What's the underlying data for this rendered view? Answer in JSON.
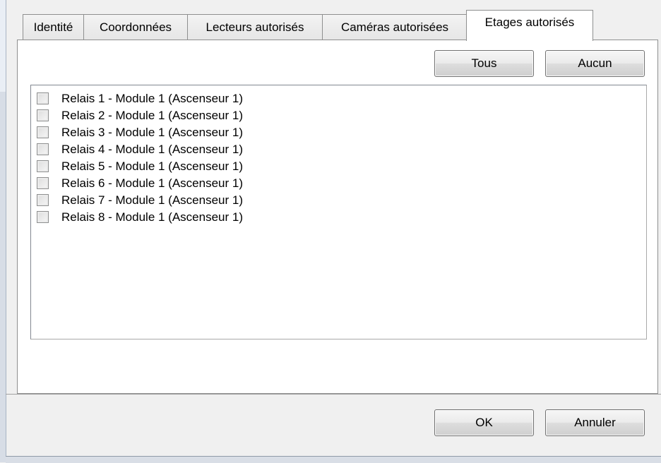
{
  "tabs": [
    {
      "label": "Identité"
    },
    {
      "label": "Coordonnées"
    },
    {
      "label": "Lecteurs autorisés"
    },
    {
      "label": "Caméras autorisées"
    },
    {
      "label": "Etages autorisés",
      "active": true
    }
  ],
  "panel": {
    "all_button": "Tous",
    "none_button": "Aucun",
    "relays": [
      {
        "label": "Relais 1 - Module 1 (Ascenseur 1)",
        "checked": false
      },
      {
        "label": "Relais 2 - Module 1 (Ascenseur 1)",
        "checked": false
      },
      {
        "label": "Relais 3 - Module 1 (Ascenseur 1)",
        "checked": false
      },
      {
        "label": "Relais 4 - Module 1 (Ascenseur 1)",
        "checked": false
      },
      {
        "label": "Relais 5 - Module 1 (Ascenseur 1)",
        "checked": false
      },
      {
        "label": "Relais 6 - Module 1 (Ascenseur 1)",
        "checked": false
      },
      {
        "label": "Relais 7 - Module 1 (Ascenseur 1)",
        "checked": false
      },
      {
        "label": "Relais 8 - Module 1 (Ascenseur 1)",
        "checked": false
      }
    ]
  },
  "footer": {
    "ok_button": "OK",
    "cancel_button": "Annuler"
  }
}
